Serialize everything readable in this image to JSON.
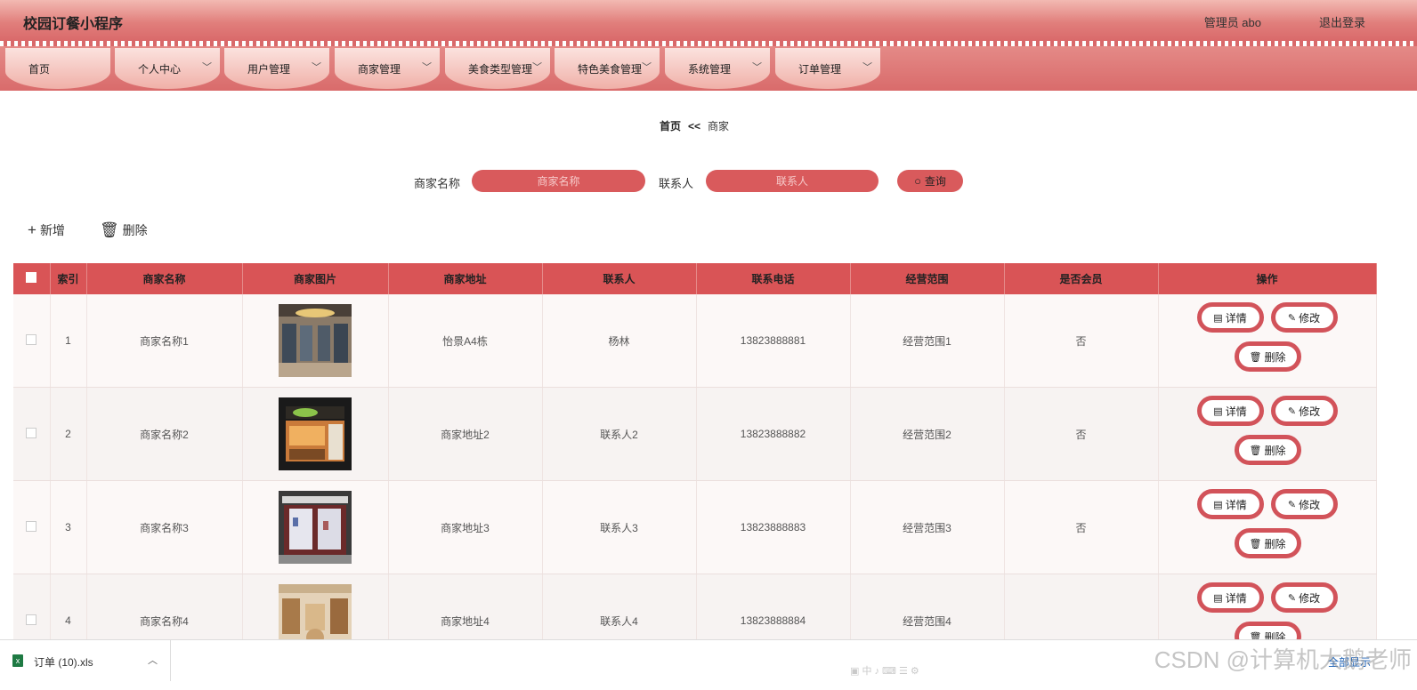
{
  "header": {
    "title": "校园订餐小程序",
    "user": "管理员 abo",
    "logout": "退出登录"
  },
  "nav": [
    {
      "label": "首页",
      "dropdown": false
    },
    {
      "label": "个人中心",
      "dropdown": true
    },
    {
      "label": "用户管理",
      "dropdown": true
    },
    {
      "label": "商家管理",
      "dropdown": true
    },
    {
      "label": "美食类型管理",
      "dropdown": true
    },
    {
      "label": "特色美食管理",
      "dropdown": true
    },
    {
      "label": "系统管理",
      "dropdown": true
    },
    {
      "label": "订单管理",
      "dropdown": true
    }
  ],
  "breadcrumb": {
    "home": "首页",
    "sep": "<<",
    "current": "商家"
  },
  "search": {
    "name_label": "商家名称",
    "name_placeholder": "商家名称",
    "contact_label": "联系人",
    "contact_placeholder": "联系人",
    "button": "查询"
  },
  "actions": {
    "add": "新增",
    "delete": "删除"
  },
  "table": {
    "columns": [
      "索引",
      "商家名称",
      "商家图片",
      "商家地址",
      "联系人",
      "联系电话",
      "经营范围",
      "是否会员",
      "操作"
    ],
    "rows": [
      {
        "index": "1",
        "name": "商家名称1",
        "address": "怡景A4栋",
        "contact": "杨林",
        "phone": "13823888881",
        "scope": "经营范围1",
        "member": "否"
      },
      {
        "index": "2",
        "name": "商家名称2",
        "address": "商家地址2",
        "contact": "联系人2",
        "phone": "13823888882",
        "scope": "经营范围2",
        "member": "否"
      },
      {
        "index": "3",
        "name": "商家名称3",
        "address": "商家地址3",
        "contact": "联系人3",
        "phone": "13823888883",
        "scope": "经营范围3",
        "member": "否"
      },
      {
        "index": "4",
        "name": "商家名称4",
        "address": "商家地址4",
        "contact": "联系人4",
        "phone": "13823888884",
        "scope": "经营范围4",
        "member": ""
      }
    ],
    "ops": {
      "detail": "详情",
      "edit": "修改",
      "delete": "删除"
    }
  },
  "download": {
    "file": "订单 (10).xls",
    "show_all": "全部显示"
  },
  "watermark": "CSDN @计算机大鹅老师",
  "colors": {
    "primary": "#d95456",
    "header_light": "#f2b9b2",
    "button_border": "#d2535a"
  }
}
